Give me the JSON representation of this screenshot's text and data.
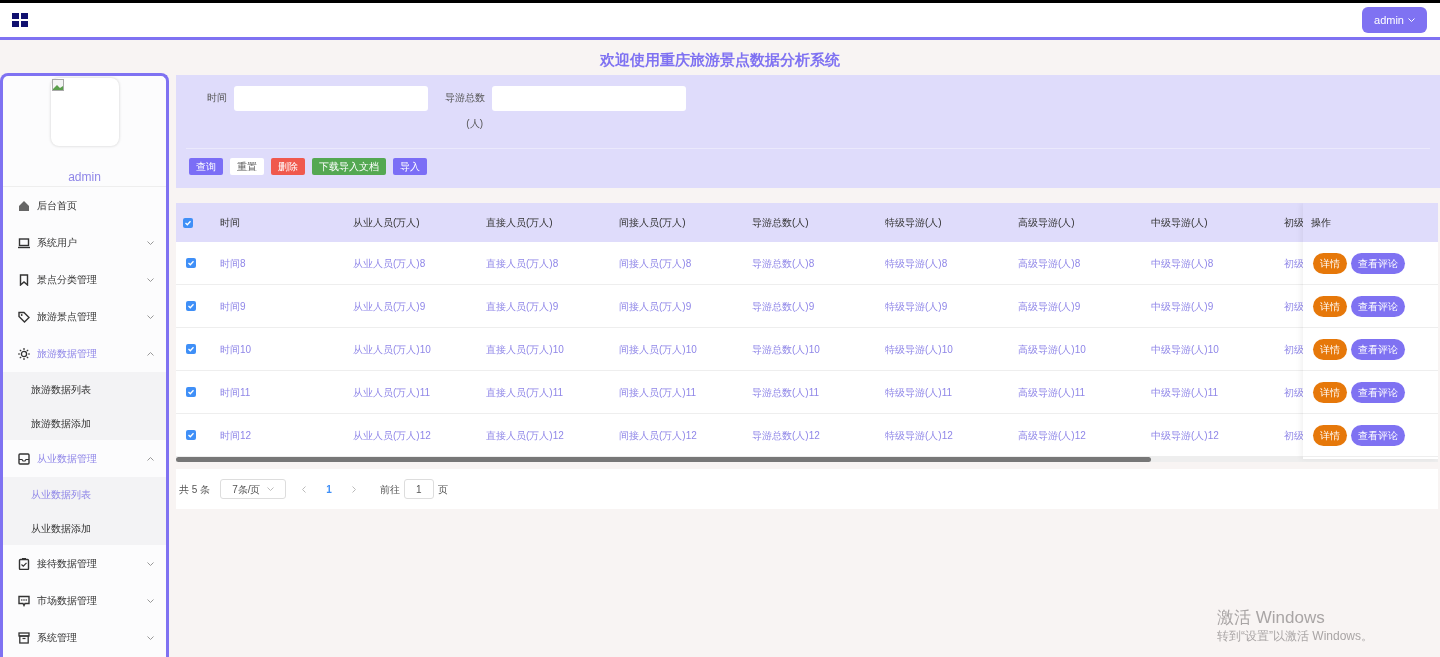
{
  "header": {
    "user_button": "admin"
  },
  "title": "欢迎使用重庆旅游景点数据分析系统",
  "sidebar": {
    "username": "admin",
    "items": [
      {
        "label": "后台首页"
      },
      {
        "label": "系统用户",
        "expanded": false
      },
      {
        "label": "景点分类管理",
        "expanded": false
      },
      {
        "label": "旅游景点管理",
        "expanded": false
      },
      {
        "label": "旅游数据管理",
        "expanded": true,
        "children": [
          {
            "label": "旅游数据列表",
            "selected": false
          },
          {
            "label": "旅游数据添加",
            "selected": false
          }
        ]
      },
      {
        "label": "从业数据管理",
        "expanded": true,
        "children": [
          {
            "label": "从业数据列表",
            "selected": true
          },
          {
            "label": "从业数据添加",
            "selected": false
          }
        ]
      },
      {
        "label": "接待数据管理",
        "expanded": false
      },
      {
        "label": "市场数据管理",
        "expanded": false
      },
      {
        "label": "系统管理",
        "expanded": false
      }
    ]
  },
  "search": {
    "fields": [
      {
        "label": "时间"
      },
      {
        "label": "导游总数",
        "label_line2": "(人)"
      }
    ],
    "buttons": [
      {
        "label": "查询",
        "kind": "primary"
      },
      {
        "label": "重置",
        "kind": "default"
      },
      {
        "label": "删除",
        "kind": "danger"
      },
      {
        "label": "下载导入文档",
        "kind": "success"
      },
      {
        "label": "导入",
        "kind": "primary"
      }
    ]
  },
  "table": {
    "all_checked": true,
    "columns": [
      "时间",
      "从业人员(万人)",
      "直接人员(万人)",
      "间接人员(万人)",
      "导游总数(人)",
      "特级导游(人)",
      "高级导游(人)",
      "中级导游(人)",
      "初级"
    ],
    "actions_column": "操作",
    "rows": [
      {
        "checked": true,
        "cells": [
          "时间8",
          "从业人员(万人)8",
          "直接人员(万人)8",
          "间接人员(万人)8",
          "导游总数(人)8",
          "特级导游(人)8",
          "高级导游(人)8",
          "中级导游(人)8",
          "初级"
        ],
        "actions": [
          "详情",
          "查看评论"
        ]
      },
      {
        "checked": true,
        "cells": [
          "时间9",
          "从业人员(万人)9",
          "直接人员(万人)9",
          "间接人员(万人)9",
          "导游总数(人)9",
          "特级导游(人)9",
          "高级导游(人)9",
          "中级导游(人)9",
          "初级"
        ],
        "actions": [
          "详情",
          "查看评论"
        ]
      },
      {
        "checked": true,
        "cells": [
          "时间10",
          "从业人员(万人)10",
          "直接人员(万人)10",
          "间接人员(万人)10",
          "导游总数(人)10",
          "特级导游(人)10",
          "高级导游(人)10",
          "中级导游(人)10",
          "初级"
        ],
        "actions": [
          "详情",
          "查看评论"
        ]
      },
      {
        "checked": true,
        "cells": [
          "时间11",
          "从业人员(万人)11",
          "直接人员(万人)11",
          "间接人员(万人)11",
          "导游总数(人)11",
          "特级导游(人)11",
          "高级导游(人)11",
          "中级导游(人)11",
          "初级"
        ],
        "actions": [
          "详情",
          "查看评论"
        ]
      },
      {
        "checked": true,
        "cells": [
          "时间12",
          "从业人员(万人)12",
          "直接人员(万人)12",
          "间接人员(万人)12",
          "导游总数(人)12",
          "特级导游(人)12",
          "高级导游(人)12",
          "中级导游(人)12",
          "初级"
        ],
        "actions": [
          "详情",
          "查看评论"
        ]
      }
    ]
  },
  "pagination": {
    "total": "共 5 条",
    "page_size": "7条/页",
    "pages": [
      {
        "label": "1",
        "selected": true
      }
    ],
    "goto_label": "前往",
    "goto_value": "1",
    "page_suffix": "页"
  },
  "os_notice": {
    "title": "激活 Windows",
    "subtitle": "转到“设置”以激活 Windows。"
  }
}
